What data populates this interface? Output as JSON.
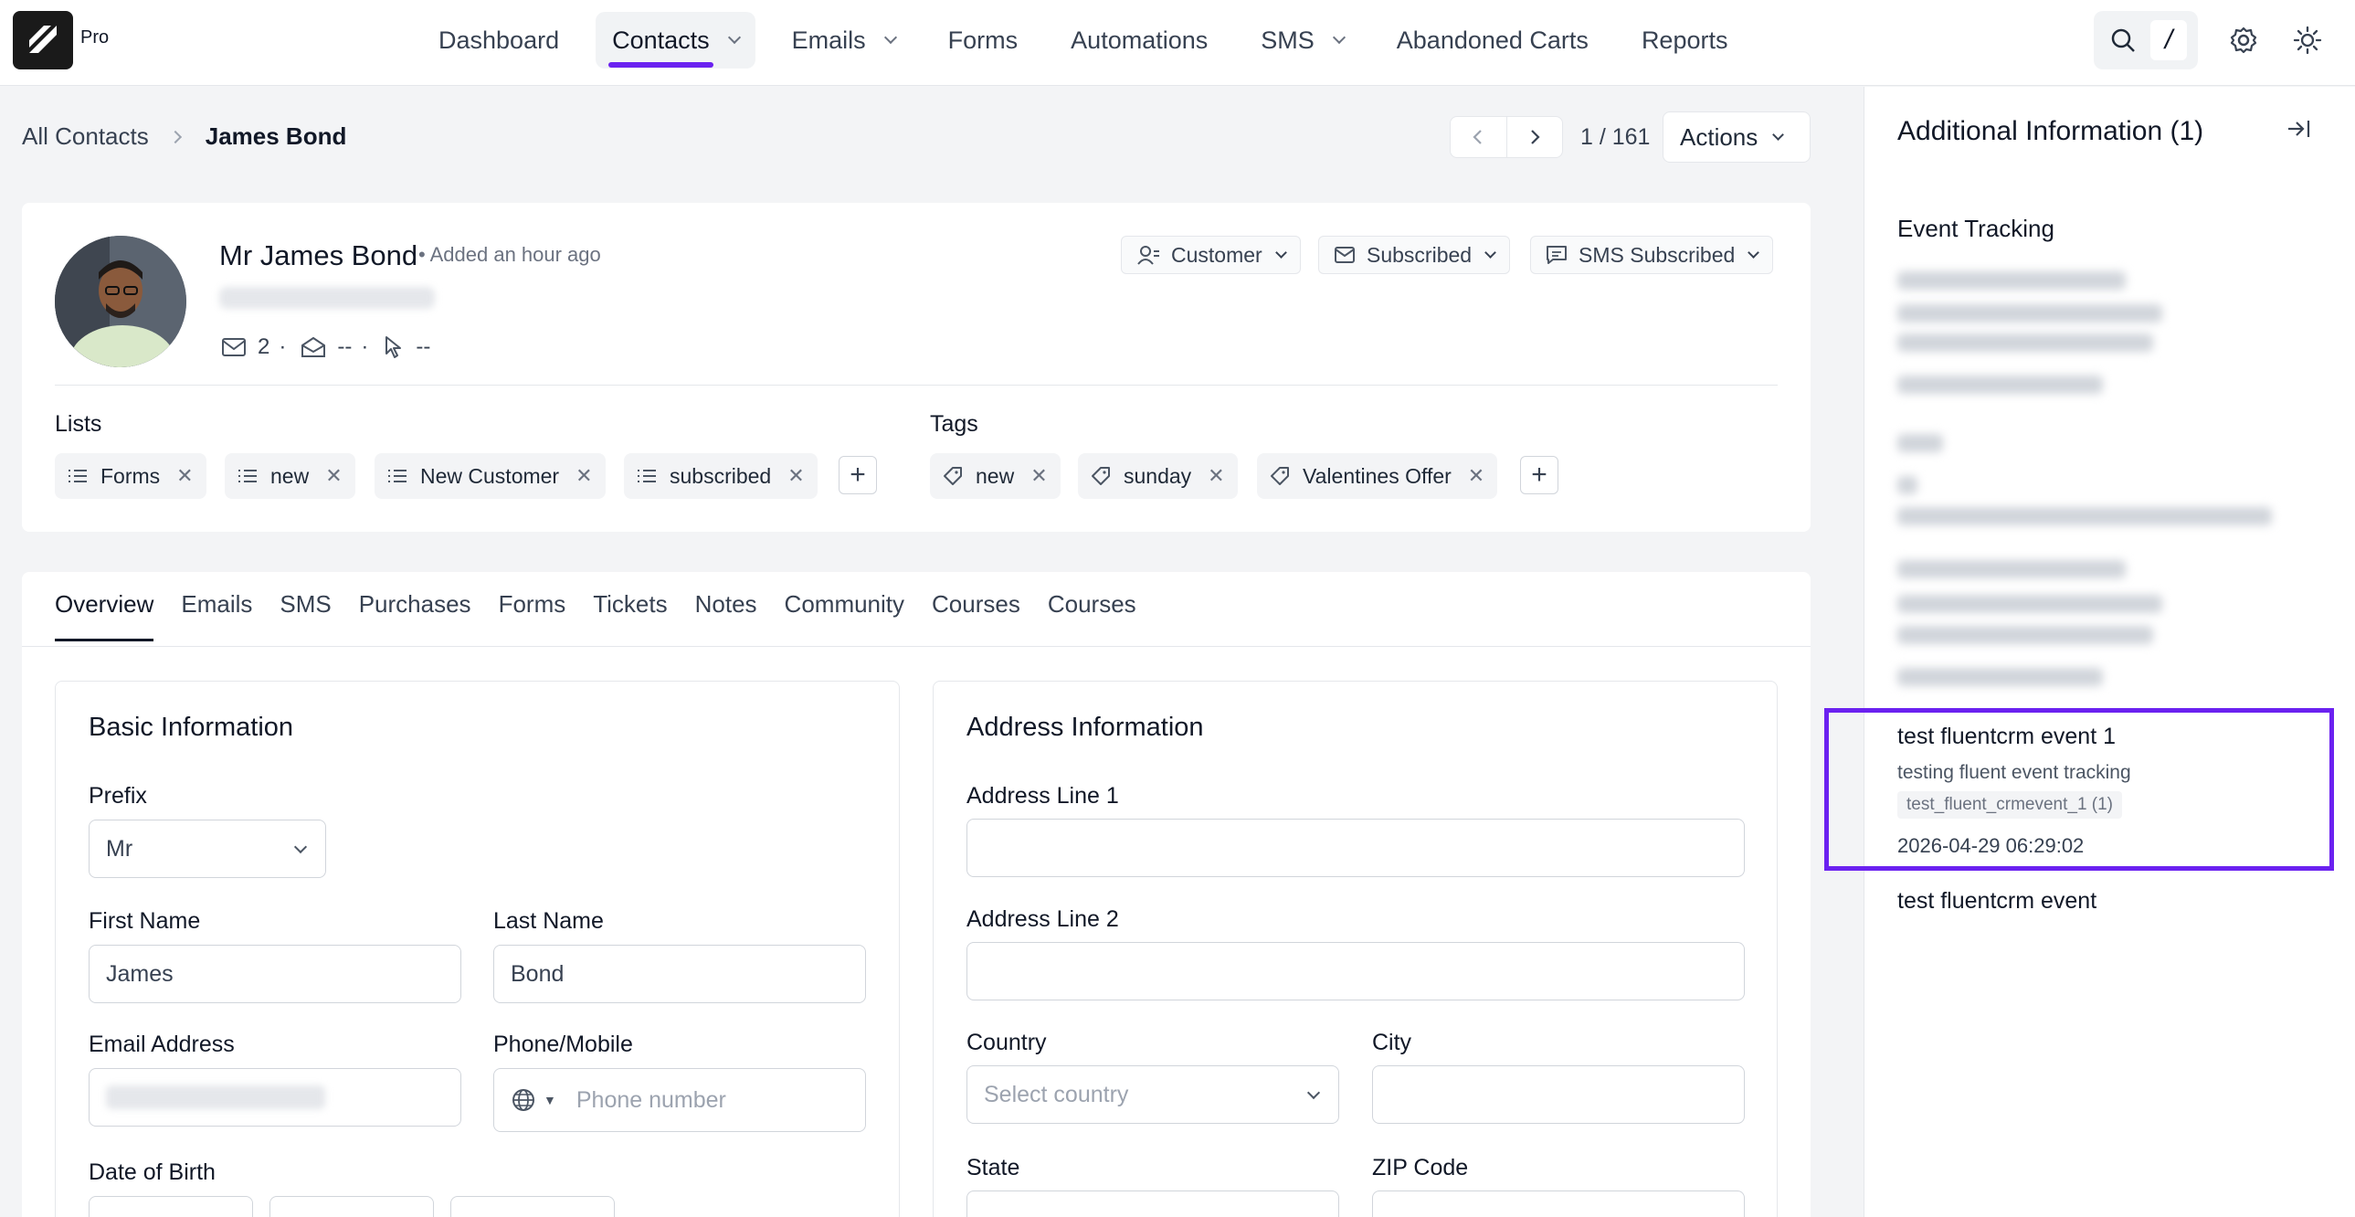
{
  "brand": {
    "badge": "Pro"
  },
  "nav": {
    "items": [
      {
        "label": "Dashboard"
      },
      {
        "label": "Contacts"
      },
      {
        "label": "Emails"
      },
      {
        "label": "Forms"
      },
      {
        "label": "Automations"
      },
      {
        "label": "SMS"
      },
      {
        "label": "Abandoned Carts"
      },
      {
        "label": "Reports"
      }
    ],
    "search_shortcut": "/"
  },
  "breadcrumb": {
    "root": "All Contacts",
    "current": "James Bond"
  },
  "pager": {
    "count": "1 / 161",
    "actions_label": "Actions"
  },
  "contact": {
    "name": "Mr James Bond",
    "added": "• Added an hour ago",
    "stats": {
      "emails": "2",
      "opens": "--",
      "clicks": "--"
    },
    "status": {
      "type": "Customer",
      "email": "Subscribed",
      "sms": "SMS Subscribed"
    }
  },
  "lists": {
    "label": "Lists",
    "items": [
      "Forms",
      "new",
      "New Customer",
      "subscribed"
    ]
  },
  "tags": {
    "label": "Tags",
    "items": [
      "new",
      "sunday",
      "Valentines Offer"
    ]
  },
  "tabs": [
    "Overview",
    "Emails",
    "SMS",
    "Purchases",
    "Forms",
    "Tickets",
    "Notes",
    "Community",
    "Courses",
    "Courses"
  ],
  "basic": {
    "title": "Basic Information",
    "prefix_label": "Prefix",
    "prefix_value": "Mr",
    "first_name_label": "First Name",
    "first_name_value": "James",
    "last_name_label": "Last Name",
    "last_name_value": "Bond",
    "email_label": "Email Address",
    "phone_label": "Phone/Mobile",
    "phone_placeholder": "Phone number",
    "dob_label": "Date of Birth"
  },
  "address": {
    "title": "Address Information",
    "line1_label": "Address Line 1",
    "line2_label": "Address Line 2",
    "country_label": "Country",
    "country_placeholder": "Select country",
    "city_label": "City",
    "state_label": "State",
    "zip_label": "ZIP Code"
  },
  "side": {
    "title": "Additional Information (1)",
    "section": "Event Tracking",
    "events": [
      {
        "title": "test fluentcrm event 1",
        "description": "testing fluent event tracking",
        "key": "test_fluent_crmevent_1 (1)",
        "date": "2026-04-29 06:29:02"
      },
      {
        "title": "test fluentcrm event"
      }
    ]
  },
  "colors": {
    "accent": "#6b21f0"
  }
}
